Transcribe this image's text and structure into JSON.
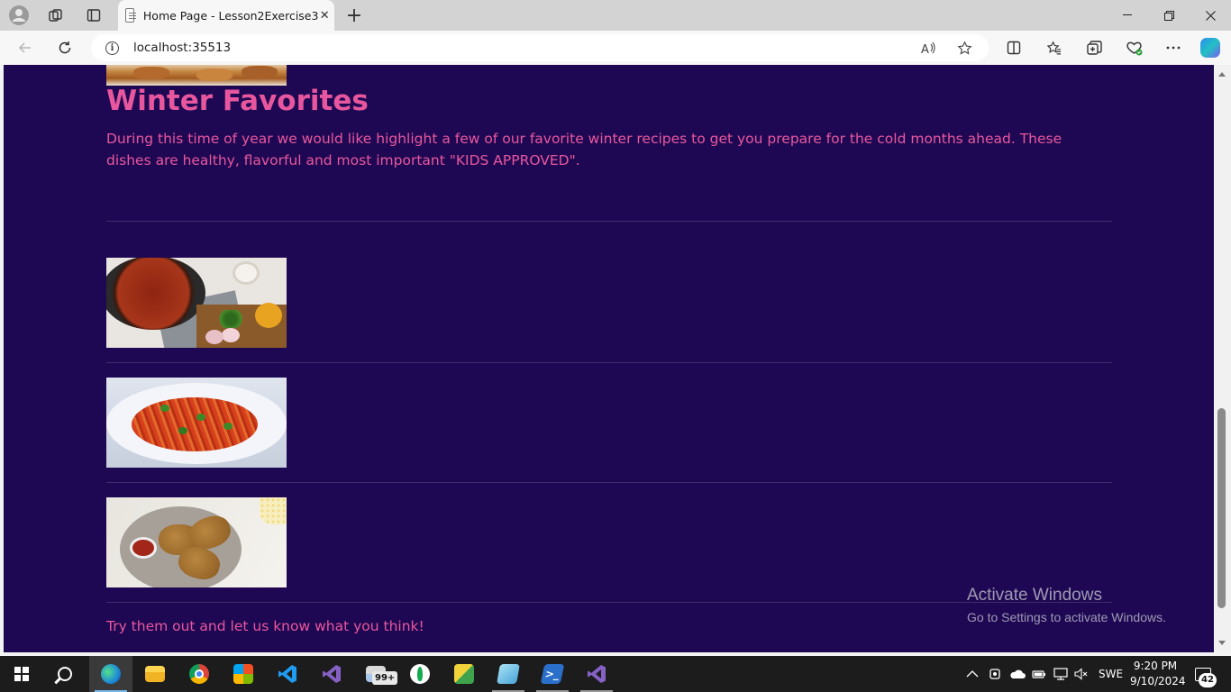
{
  "browser": {
    "tab": {
      "title": "Home Page - Lesson2Exercise3",
      "close_icon": "close-icon"
    },
    "address": {
      "url": "localhost:35513"
    },
    "icons": {
      "profile": "profile-icon",
      "workspaces": "workspaces-icon",
      "tab_actions": "vertical-tabs-icon",
      "new_tab": "plus-icon",
      "back": "back-arrow-icon",
      "refresh": "refresh-icon",
      "site_info": "info-icon",
      "read_aloud": "read-aloud-icon",
      "favorite": "star-icon",
      "split": "split-screen-icon",
      "favorites": "favorites-icon",
      "collections": "collections-icon",
      "extensions": "browser-essentials-icon",
      "more": "more-icon",
      "copilot": "copilot-icon"
    }
  },
  "page": {
    "heading": "Winter Favorites",
    "intro": "During this time of year we would like highlight a few of our favorite winter recipes to get you prepare for the cold months ahead. These dishes are healthy, flavorful and most important \"KIDS APPROVED\".",
    "recipes": [
      {
        "image": "chili-photo"
      },
      {
        "image": "spaghetti-photo"
      },
      {
        "image": "fried-chicken-photo"
      }
    ],
    "outro": "Try them out and let us know what you think!",
    "colors": {
      "background": "#1f0853",
      "text": "#e8579e"
    }
  },
  "watermark": {
    "line1": "Activate Windows",
    "line2": "Go to Settings to activate Windows."
  },
  "taskbar": {
    "mail_badge": "99+",
    "language": "SWE",
    "time": "9:20 PM",
    "date": "9/10/2024",
    "notifications": "42",
    "apps": [
      "edge",
      "file-explorer",
      "chrome",
      "microsoft-store",
      "vs-code",
      "visual-studio",
      "mail",
      "mongodb-compass",
      "tool-app",
      "notepad-app",
      "powershell",
      "visual-studio-2"
    ]
  }
}
